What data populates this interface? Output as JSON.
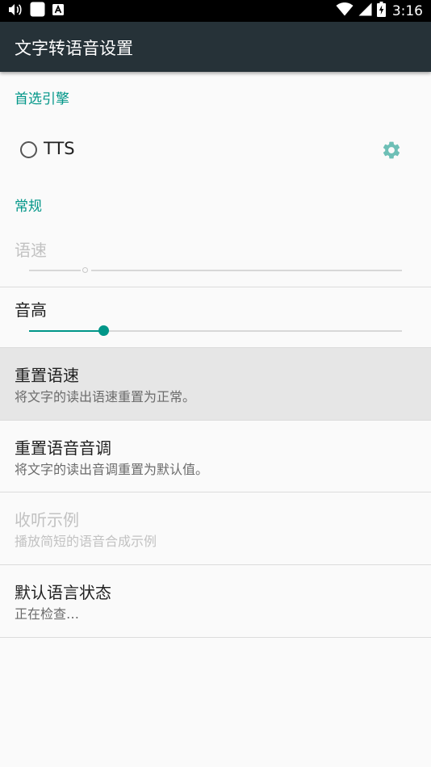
{
  "status_bar": {
    "time": "3:16",
    "icons": [
      "volume-icon",
      "notification-square-icon",
      "a-notification-icon",
      "wifi-icon",
      "signal-icon",
      "battery-charging-icon"
    ]
  },
  "app_bar": {
    "title": "文字转语音设置"
  },
  "engine_section": {
    "header": "首选引擎",
    "engine": {
      "label": "TTS",
      "selected": false
    }
  },
  "general_section": {
    "header": "常规",
    "speech_rate": {
      "label": "语速",
      "enabled": false,
      "value": 0.15
    },
    "pitch": {
      "label": "音高",
      "enabled": true,
      "value": 0.2
    }
  },
  "items": [
    {
      "title": "重置语速",
      "subtitle": "将文字的读出语速重置为正常。",
      "enabled": true,
      "pressed": true
    },
    {
      "title": "重置语音音调",
      "subtitle": "将文字的读出音调重置为默认值。",
      "enabled": true,
      "pressed": false
    },
    {
      "title": "收听示例",
      "subtitle": "播放简短的语音合成示例",
      "enabled": false,
      "pressed": false
    },
    {
      "title": "默认语言状态",
      "subtitle": "正在检查…",
      "enabled": true,
      "pressed": false
    }
  ],
  "colors": {
    "accent": "#009688",
    "app_bar": "#263238",
    "status_bar": "#000000",
    "background": "#fafafa"
  }
}
